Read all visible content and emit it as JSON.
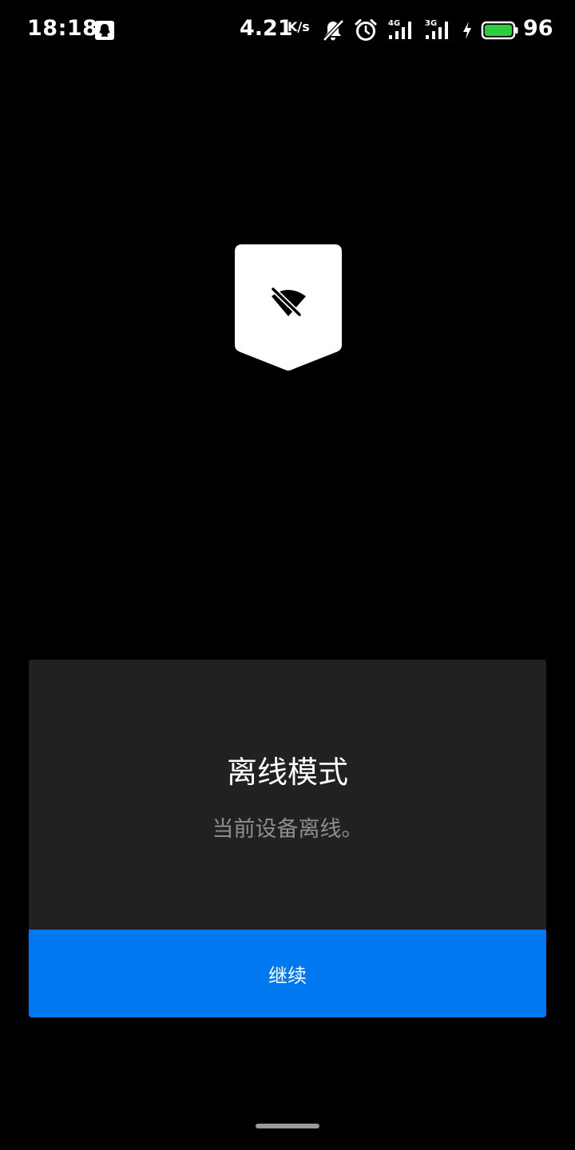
{
  "status_bar": {
    "time": "18:18",
    "net_speed": "4.21",
    "net_speed_unit": "K/s",
    "signal_1_label": "4G",
    "signal_2_label": "3G",
    "battery_level": "96",
    "battery_color": "#2ecc40",
    "icons": [
      "qq-notification-icon",
      "mute-bell-icon",
      "alarm-icon",
      "signal-4g-icon",
      "signal-3g-icon",
      "charging-bolt-icon",
      "battery-icon"
    ]
  },
  "emblem": {
    "icon": "wifi-off-icon"
  },
  "dialog": {
    "title": "离线模式",
    "message": "当前设备离线。",
    "button_label": "继续",
    "button_color": "#0078f0",
    "card_color": "#212121"
  }
}
